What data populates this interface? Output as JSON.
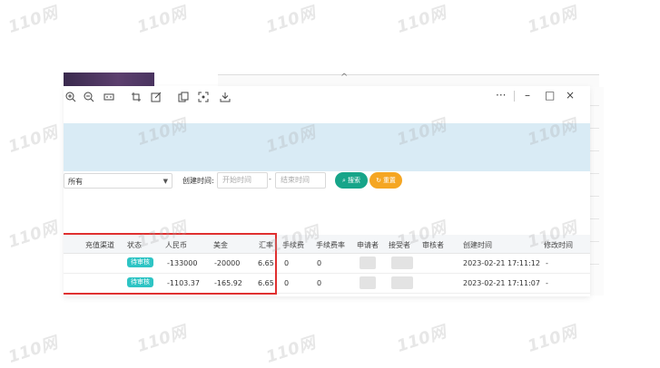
{
  "watermark_text": "110网",
  "toolbar": {
    "icons": [
      "zoom-in-icon",
      "zoom-out-icon",
      "fit-width-icon",
      "crop-icon",
      "edit-icon",
      "copy-icon",
      "screenshot-icon",
      "save-icon"
    ],
    "more_label": "···",
    "minimize_label": "–",
    "maximize_label": "□",
    "close_label": "×"
  },
  "filters": {
    "select_value": "所有",
    "created_label": "创建时间:",
    "start_placeholder": "开始时间",
    "separator": "-",
    "end_placeholder": "结束时间",
    "search_label": "搜索",
    "reset_label": "重置"
  },
  "table": {
    "columns": [
      "充值渠道",
      "状态",
      "人民币",
      "美金",
      "汇率",
      "手续费",
      "手续费率",
      "申请者",
      "接受者",
      "审核者",
      "创建时间",
      "修改时间"
    ],
    "rows": [
      {
        "status": "待审核",
        "rmb": "-133000",
        "usd": "-20000",
        "rate": "6.65",
        "fee": "0",
        "fee_rate": "0",
        "created": "2023-02-21 17:11:12",
        "modified": "-"
      },
      {
        "status": "待审核",
        "rmb": "-1103.37",
        "usd": "-165.92",
        "rate": "6.65",
        "fee": "0",
        "fee_rate": "0",
        "created": "2023-02-21 17:11:07",
        "modified": "-"
      }
    ]
  },
  "colors": {
    "banner": "#d9ebf5",
    "search_button": "#17a589",
    "reset_button": "#f5a623",
    "status_badge": "#2ec4c4",
    "highlight": "#e03030"
  }
}
